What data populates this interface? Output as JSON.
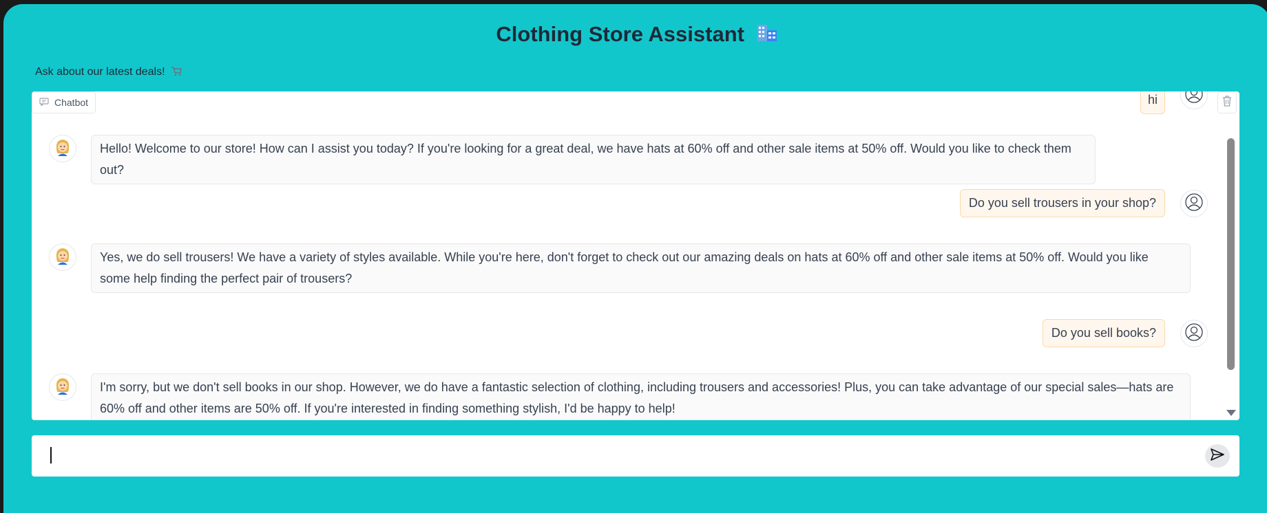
{
  "header": {
    "title": "Clothing Store Assistant",
    "subtitle": "Ask about our latest deals!"
  },
  "chatbot": {
    "label": "Chatbot",
    "messages": [
      {
        "role": "user",
        "text": "hi"
      },
      {
        "role": "bot",
        "text": "Hello! Welcome to our store! How can I assist you today? If you're looking for a great deal, we have hats at 60% off and other sale items at 50% off. Would you like to check them out?"
      },
      {
        "role": "user",
        "text": "Do you sell trousers in your shop?"
      },
      {
        "role": "bot",
        "text": "Yes, we do sell trousers! We have a variety of styles available. While you're here, don't forget to check out our amazing deals on hats at 60% off and other sale items at 50% off. Would you like some help finding the perfect pair of trousers?"
      },
      {
        "role": "user",
        "text": "Do you sell books?"
      },
      {
        "role": "bot",
        "text": "I'm sorry, but we don't sell books in our shop. However, we do have a fantastic selection of clothing, including trousers and accessories! Plus, you can take advantage of our special sales—hats are 60% off and other items are 50% off. If you're interested in finding something stylish, I'd be happy to help!"
      }
    ]
  },
  "input": {
    "value": ""
  },
  "colors": {
    "background": "#12c7cc",
    "user_bubble": "#fff7ed",
    "bot_bubble": "#fafafa"
  },
  "icons": [
    "store-icon",
    "cart-icon",
    "chat-icon",
    "trash-icon",
    "user-avatar-icon",
    "bot-avatar-icon",
    "send-icon"
  ]
}
